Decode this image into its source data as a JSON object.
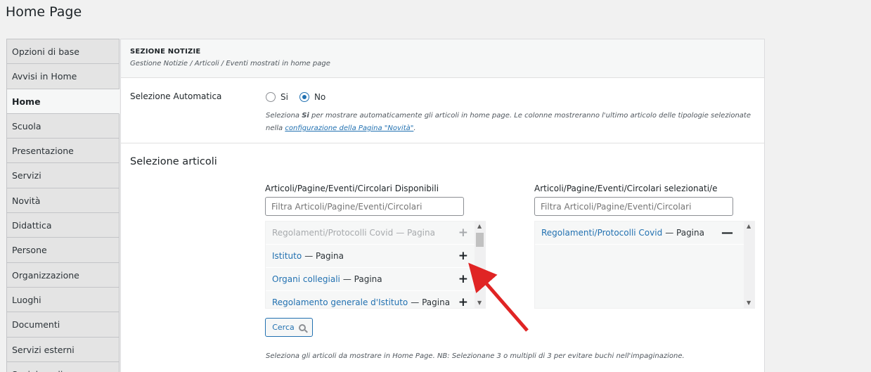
{
  "page": {
    "title": "Home Page"
  },
  "sidebar": {
    "items": [
      {
        "label": "Opzioni di base"
      },
      {
        "label": "Avvisi in Home"
      },
      {
        "label": "Home"
      },
      {
        "label": "Scuola"
      },
      {
        "label": "Presentazione"
      },
      {
        "label": "Servizi"
      },
      {
        "label": "Novità"
      },
      {
        "label": "Didattica"
      },
      {
        "label": "Persone"
      },
      {
        "label": "Organizzazione"
      },
      {
        "label": "Luoghi"
      },
      {
        "label": "Documenti"
      },
      {
        "label": "Servizi esterni"
      },
      {
        "label": "Social media"
      }
    ]
  },
  "section": {
    "title": "SEZIONE NOTIZIE",
    "subtitle": "Gestione Notizie / Articoli / Eventi mostrati in home page"
  },
  "auto_selection": {
    "label": "Selezione Automatica",
    "option_yes": "Si",
    "option_no": "No",
    "help_prefix": "Seleziona ",
    "help_bold": "Si",
    "help_mid": " per mostrare automaticamente gli articoli in home page. Le colonne mostreranno l'ultimo articolo delle tipologie selezionate nella ",
    "help_link": "configurazione della Pagina \"Novità\"",
    "help_suffix": "."
  },
  "article_selection": {
    "title": "Selezione articoli",
    "available": {
      "title": "Articoli/Pagine/Eventi/Circolari Disponibili",
      "filter_placeholder": "Filtra Articoli/Pagine/Eventi/Circolari",
      "items": [
        {
          "title": "Regolamenti/Protocolli Covid",
          "type": "— Pagina"
        },
        {
          "title": "Istituto",
          "type": "— Pagina"
        },
        {
          "title": "Organi collegiali",
          "type": "— Pagina"
        },
        {
          "title": "Regolamento generale d'Istituto",
          "type": "— Pagina"
        }
      ]
    },
    "selected": {
      "title": "Articoli/Pagine/Eventi/Circolari selezionati/e",
      "filter_placeholder": "Filtra Articoli/Pagine/Eventi/Circolari",
      "items": [
        {
          "title": "Regolamenti/Protocolli Covid",
          "type": "— Pagina"
        }
      ]
    },
    "search_label": "Cerca",
    "help": "Seleziona gli articoli da mostrare in Home Page. NB: Selezionane 3 o multipli di 3 per evitare buchi nell'impaginazione."
  },
  "icons": {
    "add": "plus-icon",
    "remove": "minus-icon",
    "search": "magnifier-icon"
  },
  "colors": {
    "link": "#2271b1",
    "arrow": "#e02424"
  }
}
